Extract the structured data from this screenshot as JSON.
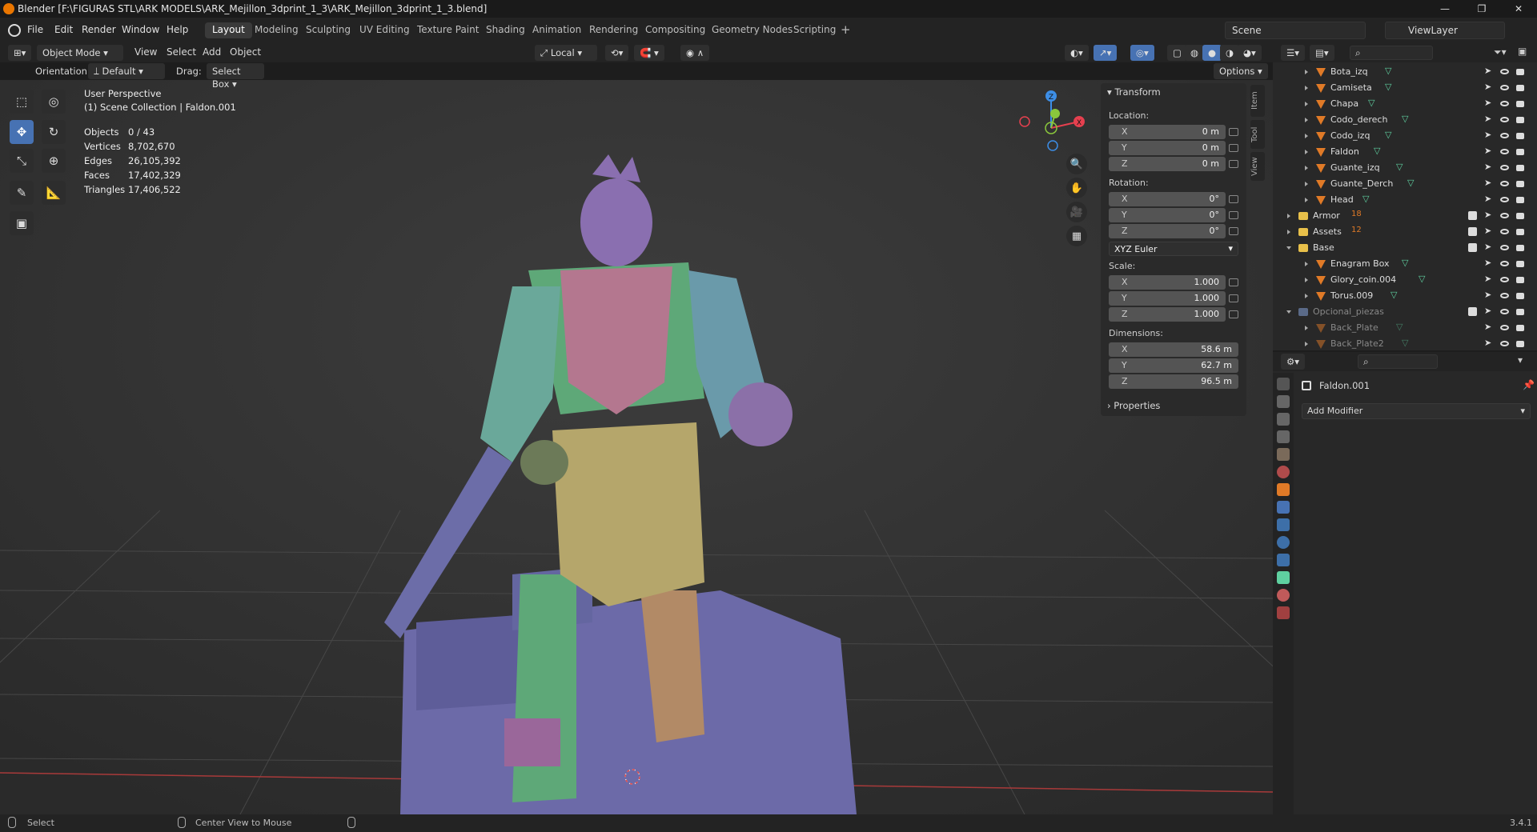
{
  "titlebar": {
    "title": "Blender [F:\\FIGURAS STL\\ARK MODELS\\ARK_Mejillon_3dprint_1_3\\ARK_Mejillon_3dprint_1_3.blend]"
  },
  "menu": [
    "File",
    "Edit",
    "Render",
    "Window",
    "Help"
  ],
  "workspaces": [
    "Layout",
    "Modeling",
    "Sculpting",
    "UV Editing",
    "Texture Paint",
    "Shading",
    "Animation",
    "Rendering",
    "Compositing",
    "Geometry Nodes",
    "Scripting"
  ],
  "active_workspace": "Layout",
  "scene": {
    "name": "Scene",
    "view_layer": "ViewLayer"
  },
  "header": {
    "mode": "Object Mode",
    "view_menu": [
      "View",
      "Select",
      "Add",
      "Object"
    ],
    "transform_space": "Local",
    "options": "Options",
    "orientation_label": "Orientation:",
    "orientation_value": "Default",
    "drag_label": "Drag:",
    "drag_value": "Select Box"
  },
  "viewport": {
    "perspective": "User Perspective",
    "collection": "(1) Scene Collection | Faldon.001",
    "stats": [
      {
        "label": "Objects",
        "value": "0 / 43"
      },
      {
        "label": "Vertices",
        "value": "8,702,670"
      },
      {
        "label": "Edges",
        "value": "26,105,392"
      },
      {
        "label": "Faces",
        "value": "17,402,329"
      },
      {
        "label": "Triangles",
        "value": "17,406,522"
      }
    ],
    "gizmo": {
      "x": "X",
      "y": "Y",
      "z": "Z"
    }
  },
  "npanel": {
    "tabs": [
      "Item",
      "Tool",
      "View"
    ],
    "transform_title": "Transform",
    "location_label": "Location:",
    "location": [
      {
        "axis": "X",
        "value": "0 m"
      },
      {
        "axis": "Y",
        "value": "0 m"
      },
      {
        "axis": "Z",
        "value": "0 m"
      }
    ],
    "rotation_label": "Rotation:",
    "rotation": [
      {
        "axis": "X",
        "value": "0°"
      },
      {
        "axis": "Y",
        "value": "0°"
      },
      {
        "axis": "Z",
        "value": "0°"
      }
    ],
    "rotation_mode": "XYZ Euler",
    "scale_label": "Scale:",
    "scale": [
      {
        "axis": "X",
        "value": "1.000"
      },
      {
        "axis": "Y",
        "value": "1.000"
      },
      {
        "axis": "Z",
        "value": "1.000"
      }
    ],
    "dimensions_label": "Dimensions:",
    "dimensions": [
      {
        "axis": "X",
        "value": "58.6 m"
      },
      {
        "axis": "Y",
        "value": "62.7 m"
      },
      {
        "axis": "Z",
        "value": "96.5 m"
      }
    ],
    "properties_title": "Properties"
  },
  "outliner": {
    "items": [
      {
        "name": "Bota_izq",
        "level": 2,
        "type": "object",
        "dim": false
      },
      {
        "name": "Camiseta",
        "level": 2,
        "type": "object",
        "dim": false
      },
      {
        "name": "Chapa",
        "level": 2,
        "type": "object",
        "dim": false
      },
      {
        "name": "Codo_derech",
        "level": 2,
        "type": "object",
        "dim": false
      },
      {
        "name": "Codo_izq",
        "level": 2,
        "type": "object",
        "dim": false
      },
      {
        "name": "Faldon",
        "level": 2,
        "type": "object",
        "dim": false
      },
      {
        "name": "Guante_izq",
        "level": 2,
        "type": "object",
        "dim": false
      },
      {
        "name": "Guante_Derch",
        "level": 2,
        "type": "object",
        "dim": false
      },
      {
        "name": "Head",
        "level": 2,
        "type": "object",
        "dim": false
      },
      {
        "name": "Armor",
        "level": 1,
        "type": "collection",
        "count": "18",
        "dim": false
      },
      {
        "name": "Assets",
        "level": 1,
        "type": "collection",
        "count": "12",
        "dim": false
      },
      {
        "name": "Base",
        "level": 1,
        "type": "collection",
        "open": true,
        "dim": false
      },
      {
        "name": "Enagram Box",
        "level": 2,
        "type": "object",
        "dim": false
      },
      {
        "name": "Glory_coin.004",
        "level": 2,
        "type": "object",
        "dim": false
      },
      {
        "name": "Torus.009",
        "level": 2,
        "type": "object",
        "dim": false
      },
      {
        "name": "Opcional_piezas",
        "level": 1,
        "type": "collection",
        "open": true,
        "dim": true
      },
      {
        "name": "Back_Plate",
        "level": 2,
        "type": "object",
        "dim": true
      },
      {
        "name": "Back_Plate2",
        "level": 2,
        "type": "object",
        "dim": true
      }
    ]
  },
  "properties": {
    "object_name": "Faldon.001",
    "add_modifier": "Add Modifier"
  },
  "statusbar": {
    "select": "Select",
    "center": "Center View to Mouse",
    "version": "3.4.1"
  },
  "colors": {
    "accent": "#4772b3",
    "object_orange": "#e07a27",
    "mesh_green": "#5fd0a0",
    "x_axis": "#e6404f",
    "y_axis": "#8ac73c",
    "z_axis": "#3d8ee6"
  }
}
